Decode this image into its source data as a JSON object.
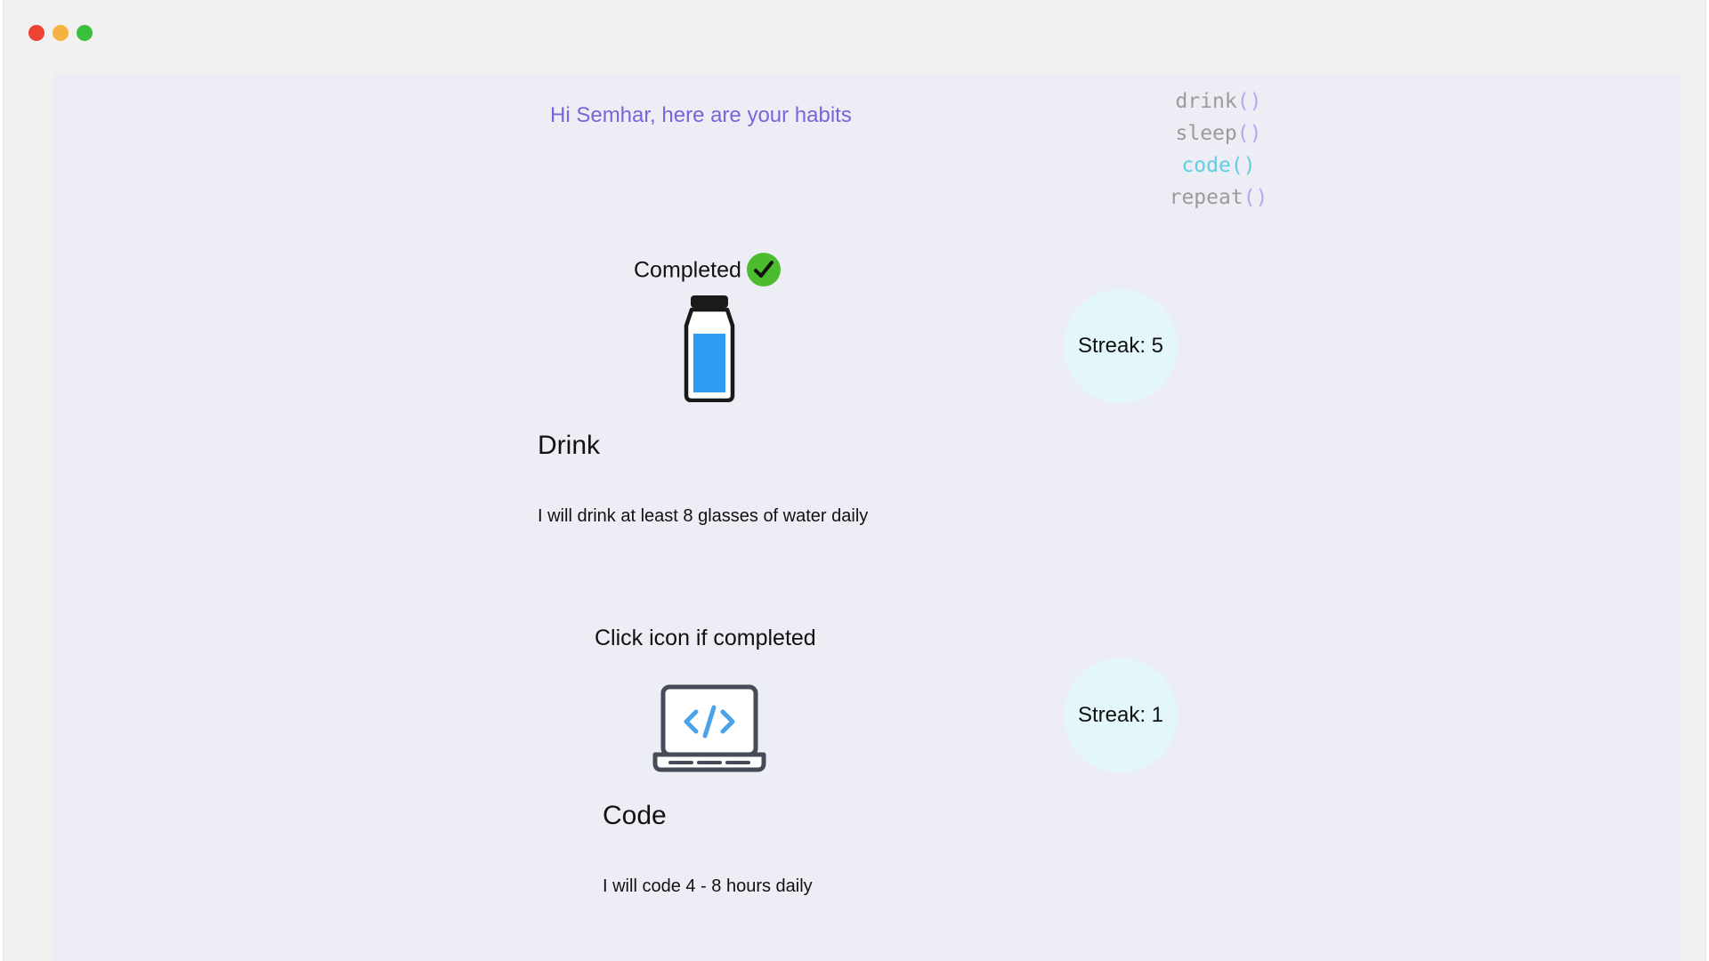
{
  "greeting": "Hi Semhar, here are your habits",
  "menu": [
    {
      "name": "drink",
      "parens": "()",
      "active": false
    },
    {
      "name": "sleep",
      "parens": "()",
      "active": false
    },
    {
      "name": "code",
      "parens": "()",
      "active": true
    },
    {
      "name": "repeat",
      "parens": "()",
      "active": false
    }
  ],
  "habits": [
    {
      "status": "Completed",
      "completed": true,
      "icon": "water-bottle-icon",
      "title": "Drink",
      "description": "I will drink at least 8 glasses of water daily",
      "streak": "Streak: 5"
    },
    {
      "status": "Click icon if completed",
      "completed": false,
      "icon": "laptop-code-icon",
      "title": "Code",
      "description": "I will code 4 - 8 hours daily",
      "streak": "Streak: 1"
    }
  ],
  "colors": {
    "accent": "#7b63da",
    "active_menu": "#61cde1",
    "check_green": "#4cbb2e",
    "water_blue": "#2d9bf0",
    "streak_bg": "#e3f7fa"
  }
}
